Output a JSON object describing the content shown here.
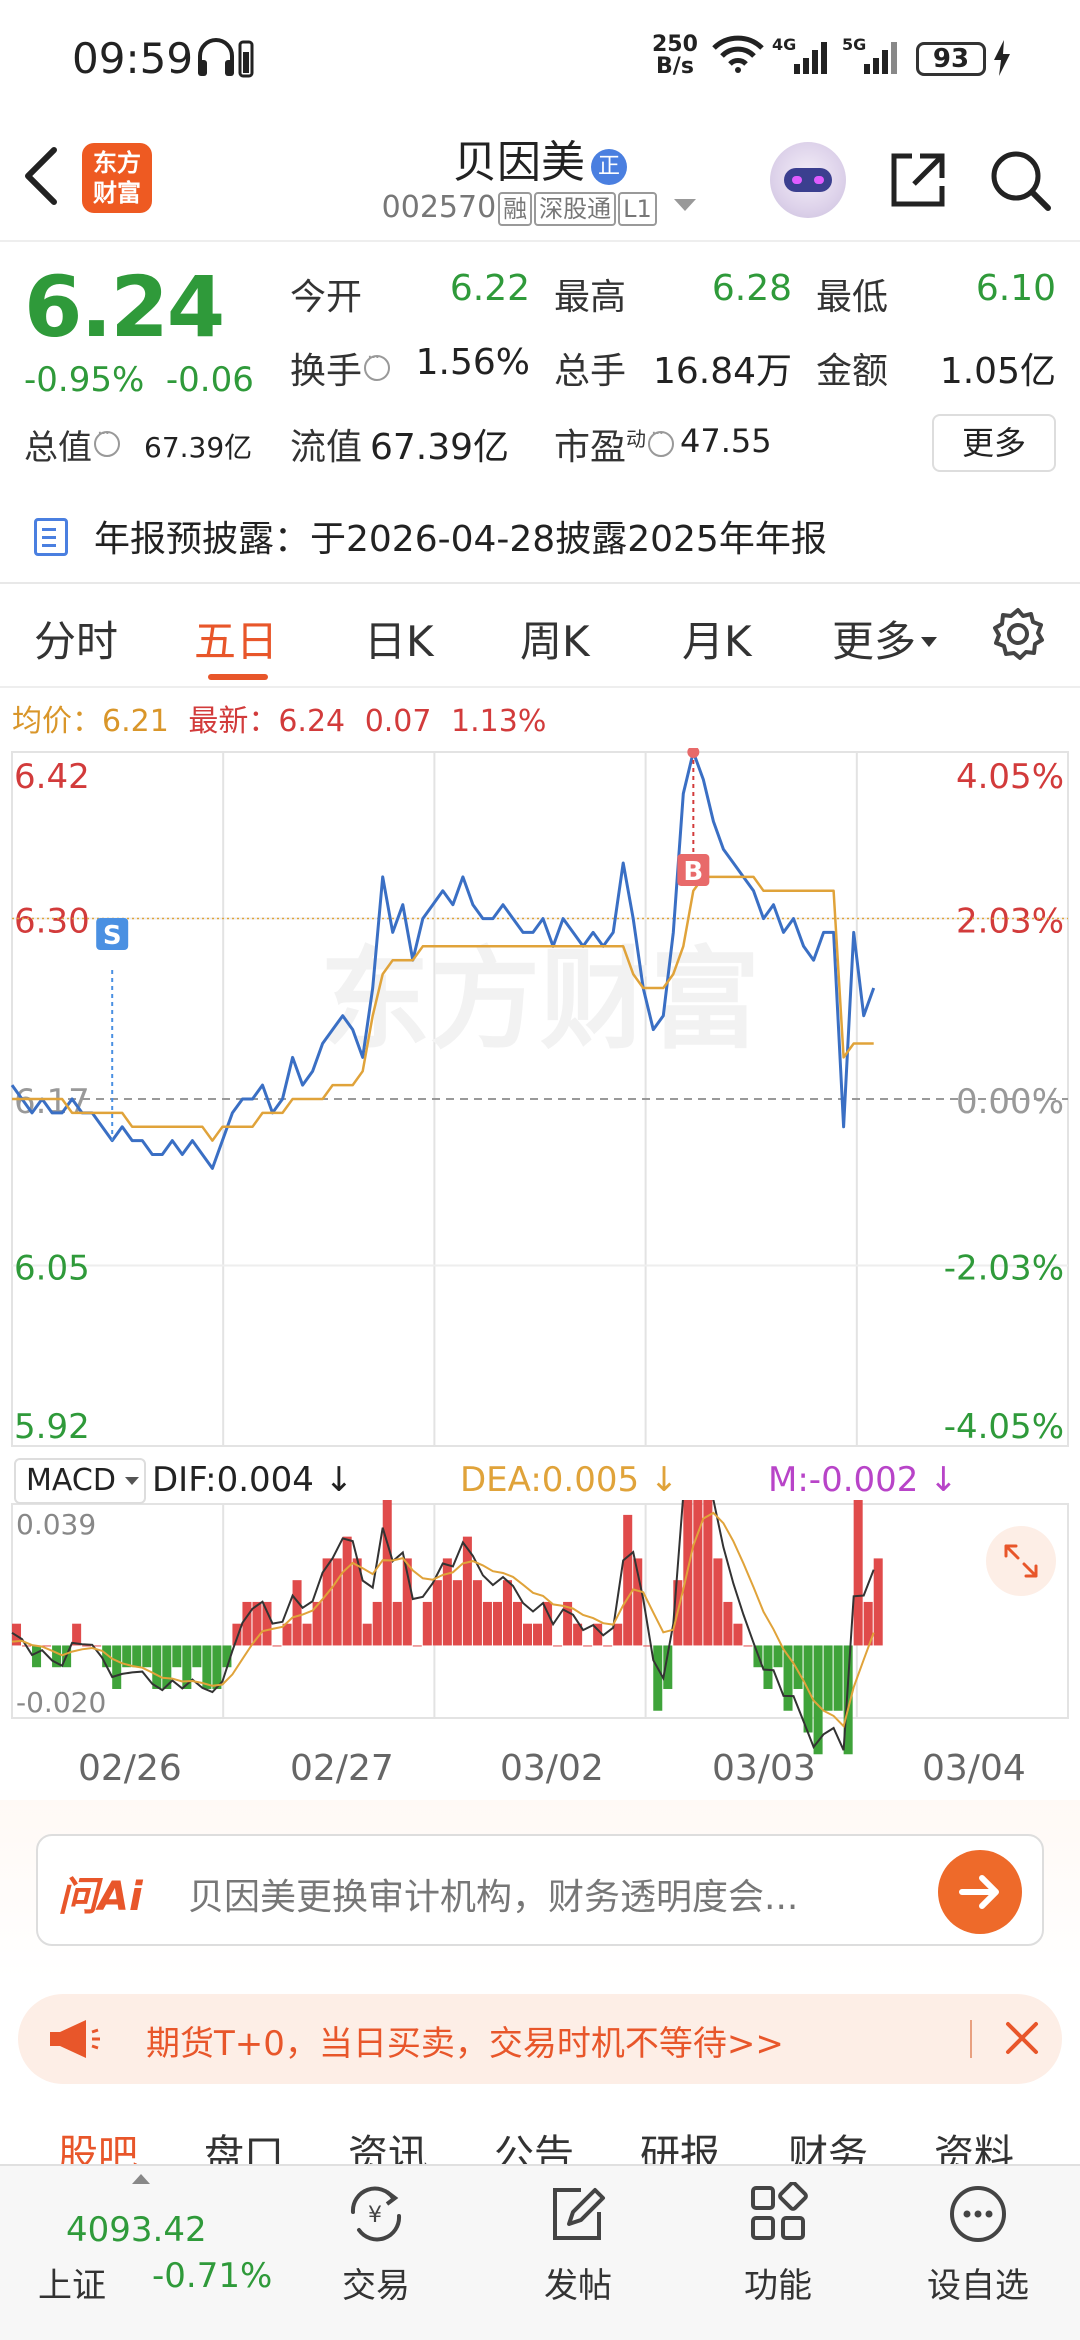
{
  "status_bar": {
    "time": "09:59",
    "net_rate_top": "250",
    "net_rate_bottom": "B/s",
    "sig1": "4G",
    "sig2": "5G",
    "battery": "93"
  },
  "header": {
    "logo_line1": "东方",
    "logo_line2": "财富",
    "stock_name": "贝因美",
    "position_badge": "正",
    "stock_code": "002570",
    "tags": [
      "融",
      "深股通",
      "L1"
    ]
  },
  "quote": {
    "price": "6.24",
    "change_pct": "-0.95%",
    "change_amt": "-0.06",
    "open_label": "今开",
    "open": "6.22",
    "high_label": "最高",
    "high": "6.28",
    "low_label": "最低",
    "low": "6.10",
    "turnover_label": "换手",
    "turnover": "1.56%",
    "volume_label": "总手",
    "volume": "16.84万",
    "amount_label": "金额",
    "amount": "1.05亿",
    "mktcap_label": "总值",
    "mktcap": "67.39亿",
    "float_label": "流值",
    "float_cap": "67.39亿",
    "pe_label": "市盈",
    "pe_super": "动",
    "pe": "47.55",
    "more_button": "更多"
  },
  "notice": {
    "text": "年报预披露：于2026-04-28披露2025年年报"
  },
  "tabs": [
    "分时",
    "五日",
    "日K",
    "周K",
    "月K",
    "更多"
  ],
  "active_tab": "五日",
  "avg_line": {
    "avg_label": "均价：",
    "avg": "6.21",
    "latest_label": "最新：",
    "latest": "6.24",
    "change": "0.07",
    "change_pct": "1.13%"
  },
  "chart_data": {
    "type": "line",
    "x": [
      "02/26",
      "02/27",
      "03/02",
      "03/03",
      "03/04"
    ],
    "y_ticks_left": [
      "6.42",
      "6.30",
      "6.17",
      "6.05",
      "5.92"
    ],
    "y_ticks_right": [
      "4.05%",
      "2.03%",
      "0.00%",
      "-2.03%",
      "-4.05%"
    ],
    "ylim": [
      5.92,
      6.42
    ],
    "prev_close": 6.17,
    "watermark": "东方财富",
    "marker_sell": "S",
    "marker_buy": "B",
    "series": [
      {
        "color": "#3a6fc4",
        "values": [
          6.18,
          6.17,
          6.16,
          6.17,
          6.16,
          6.16,
          6.17,
          6.16,
          6.16,
          6.15,
          6.14,
          6.15,
          6.14,
          6.14,
          6.13,
          6.13,
          6.14,
          6.13,
          6.14,
          6.13,
          6.12,
          6.14,
          6.16,
          6.17,
          6.17,
          6.18,
          6.16,
          6.17,
          6.2,
          6.18,
          6.19,
          6.21,
          6.22,
          6.23,
          6.22,
          6.2,
          6.25,
          6.33,
          6.29,
          6.31,
          6.27,
          6.3,
          6.31,
          6.32,
          6.31,
          6.33,
          6.31,
          6.3,
          6.3,
          6.31,
          6.3,
          6.29,
          6.29,
          6.3,
          6.28,
          6.3,
          6.29,
          6.28,
          6.29,
          6.28,
          6.29,
          6.34,
          6.3,
          6.25,
          6.22,
          6.23,
          6.29,
          6.39,
          6.42,
          6.4,
          6.37,
          6.35,
          6.34,
          6.33,
          6.32,
          6.3,
          6.31,
          6.29,
          6.3,
          6.28,
          6.27,
          6.29,
          6.29,
          6.15,
          6.29,
          6.23,
          6.25
        ]
      },
      {
        "color": "#e0a33a",
        "values": [
          6.17,
          6.17,
          6.17,
          6.17,
          6.17,
          6.17,
          6.16,
          6.16,
          6.16,
          6.16,
          6.16,
          6.16,
          6.15,
          6.15,
          6.15,
          6.15,
          6.15,
          6.15,
          6.15,
          6.15,
          6.14,
          6.15,
          6.15,
          6.15,
          6.15,
          6.16,
          6.16,
          6.16,
          6.17,
          6.17,
          6.17,
          6.17,
          6.18,
          6.18,
          6.18,
          6.19,
          6.23,
          6.26,
          6.27,
          6.27,
          6.27,
          6.28,
          6.28,
          6.28,
          6.28,
          6.28,
          6.28,
          6.28,
          6.28,
          6.28,
          6.28,
          6.28,
          6.28,
          6.28,
          6.28,
          6.28,
          6.28,
          6.28,
          6.28,
          6.28,
          6.28,
          6.28,
          6.26,
          6.25,
          6.25,
          6.25,
          6.26,
          6.28,
          6.32,
          6.33,
          6.33,
          6.33,
          6.33,
          6.33,
          6.33,
          6.32,
          6.32,
          6.32,
          6.32,
          6.32,
          6.32,
          6.32,
          6.32,
          6.2,
          6.21,
          6.21,
          6.21
        ]
      }
    ],
    "macd": {
      "label": "MACD",
      "dif_label": "DIF:",
      "dif": "0.004",
      "dea_label": "DEA:",
      "dea": "0.005",
      "m_label": "M:",
      "m": "-0.002",
      "y_ticks": [
        "0.039",
        "-0.020"
      ],
      "ylim": [
        -0.02,
        0.039
      ]
    }
  },
  "ai_search": {
    "logo": "问Ai",
    "placeholder": "贝因美更换审计机构，财务透明度会..."
  },
  "promo": {
    "text": "期货T+0，当日买卖，交易时机不等待>>"
  },
  "sub_tabs": [
    "股吧",
    "盘口",
    "资讯",
    "公告",
    "研报",
    "财务",
    "资料"
  ],
  "bottom_nav": {
    "index_value": "4093.42",
    "index_name": "上证",
    "index_change": "-0.71%",
    "items": [
      "交易",
      "发帖",
      "功能",
      "设自选"
    ]
  }
}
